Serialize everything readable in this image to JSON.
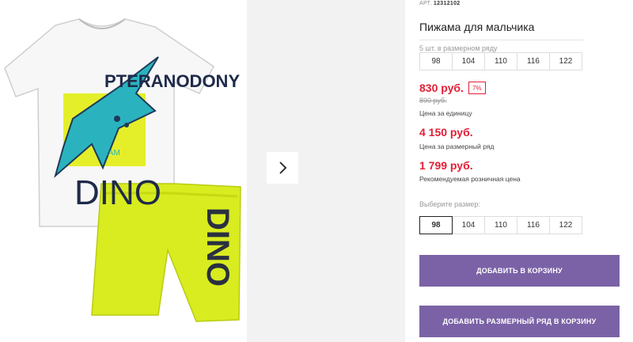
{
  "product": {
    "sku_label": "АРТ.",
    "sku_value": "12312102",
    "title": "Пижама для мальчика",
    "pack_note": "5 шт. в размерном ряду",
    "pack_sizes": [
      "98",
      "104",
      "110",
      "116",
      "122"
    ],
    "price": "830 руб.",
    "discount": "7%",
    "old_price": "890 руб.",
    "price_caption": "Цена за единицу",
    "pack_price": "4 150 руб.",
    "pack_price_caption": "Цена за размерный ряд",
    "rrp": "1 799 руб.",
    "rrp_caption": "Рекомендуемая розничная цена",
    "choose_label": "Выберите размер:",
    "select_sizes": [
      "98",
      "104",
      "110",
      "116",
      "122"
    ],
    "selected_size": "98",
    "add_to_cart": "ДОБАВИТЬ В КОРЗИНУ",
    "add_pack_to_cart": "ДОБАВИТЬ РАЗМЕРНЫЙ РЯД В КОРЗИНУ"
  },
  "image": {
    "shirt_print_top": "PTERANODONY",
    "shirt_print_team": "TEAM",
    "shirt_print_bottom": "DINO",
    "shorts_print": "DINO"
  },
  "colors": {
    "price": "#e31e36",
    "button": "#7b62a6",
    "shorts": "#d8ec20",
    "dino": "#2ab3bf"
  },
  "icons": {
    "next": "chevron-right-icon"
  }
}
